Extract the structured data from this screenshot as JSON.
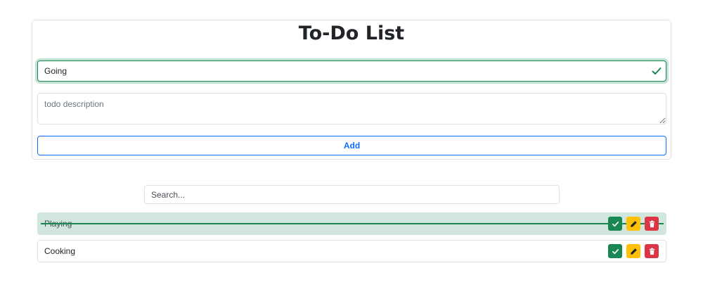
{
  "app": {
    "title": "To-Do List"
  },
  "form": {
    "title_value": "Going",
    "description_placeholder": "todo description",
    "description_value": "",
    "add_label": "Add"
  },
  "search": {
    "placeholder": "Search...",
    "value": ""
  },
  "todos": [
    {
      "label": "Playing",
      "completed": true
    },
    {
      "label": "Cooking",
      "completed": false
    }
  ],
  "colors": {
    "success": "#198754",
    "warning": "#ffc107",
    "danger": "#dc3545",
    "primary": "#0d6efd",
    "completed_row": "#d1e7dd"
  },
  "icons": {
    "valid": "check-icon",
    "complete": "check-icon",
    "edit": "pencil-icon",
    "delete": "trash-icon"
  }
}
